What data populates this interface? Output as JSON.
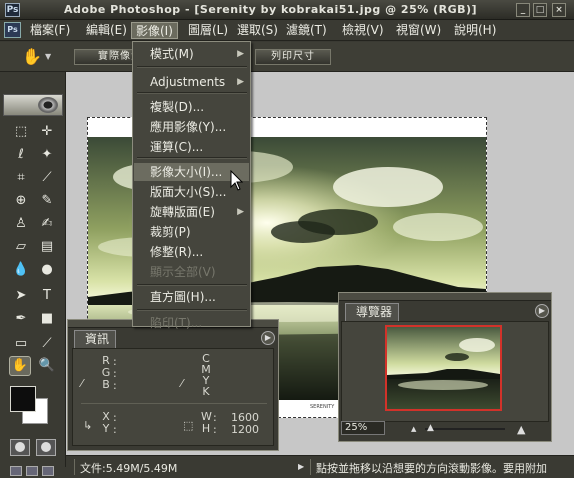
{
  "window": {
    "title": "Adobe Photoshop - [Serenity by kobrakai51.jpg @ 25% (RGB)]",
    "app_icon_text": "Ps",
    "controls": [
      "_",
      "□",
      "×"
    ]
  },
  "menubar": {
    "logo_text": "Ps",
    "items": [
      "檔案(F)",
      "編輯(E)",
      "影像(I)",
      "圖層(L)",
      "選取(S)",
      "濾鏡(T)",
      "檢視(V)",
      "視窗(W)",
      "說明(H)"
    ],
    "active_index": 2
  },
  "options_bar": {
    "tool_icon": "hand-icon",
    "tool_glyph": "✋",
    "buttons": [
      "實際像素",
      "列印尺寸"
    ]
  },
  "image_menu": {
    "items": [
      {
        "label": "模式(M)",
        "submenu": true,
        "enabled": true
      },
      {
        "label": "Adjustments",
        "submenu": true,
        "enabled": true
      },
      {
        "label": "複製(D)...",
        "submenu": false,
        "enabled": true
      },
      {
        "label": "應用影像(Y)...",
        "submenu": false,
        "enabled": true
      },
      {
        "label": "運算(C)...",
        "submenu": false,
        "enabled": true
      },
      {
        "label": "影像大小(I)...",
        "submenu": false,
        "enabled": true,
        "highlighted": true
      },
      {
        "label": "版面大小(S)...",
        "submenu": false,
        "enabled": true
      },
      {
        "label": "旋轉版面(E)",
        "submenu": true,
        "enabled": true
      },
      {
        "label": "裁剪(P)",
        "submenu": false,
        "enabled": true
      },
      {
        "label": "修整(R)...",
        "submenu": false,
        "enabled": true
      },
      {
        "label": "顯示全部(V)",
        "submenu": false,
        "enabled": false
      },
      {
        "label": "直方圖(H)...",
        "submenu": false,
        "enabled": true
      },
      {
        "label": "陷印(T)...",
        "submenu": false,
        "enabled": false
      }
    ],
    "arrow_glyph": "▶"
  },
  "document": {
    "caption": "SERENITY"
  },
  "info_panel": {
    "tab": "資訊",
    "rgb_labels": [
      "R",
      "G",
      "B"
    ],
    "cmyk_labels": [
      "C",
      "M",
      "Y",
      "K"
    ],
    "xy_labels": [
      "X",
      "Y"
    ],
    "wh_labels": [
      "W",
      "H"
    ],
    "w_value": "1600",
    "h_value": "1200",
    "colon": ":"
  },
  "navigator_panel": {
    "tab": "導覽器",
    "zoom": "25%"
  },
  "statusbar": {
    "doc_size": "文件:5.49M/5.49M",
    "hint": "點按並拖移以沿想要的方向滾動影像。要用附加"
  },
  "colors": {
    "foreground": "#0d0d0d",
    "background": "#ffffff",
    "navigator_frame": "#d2322a"
  }
}
